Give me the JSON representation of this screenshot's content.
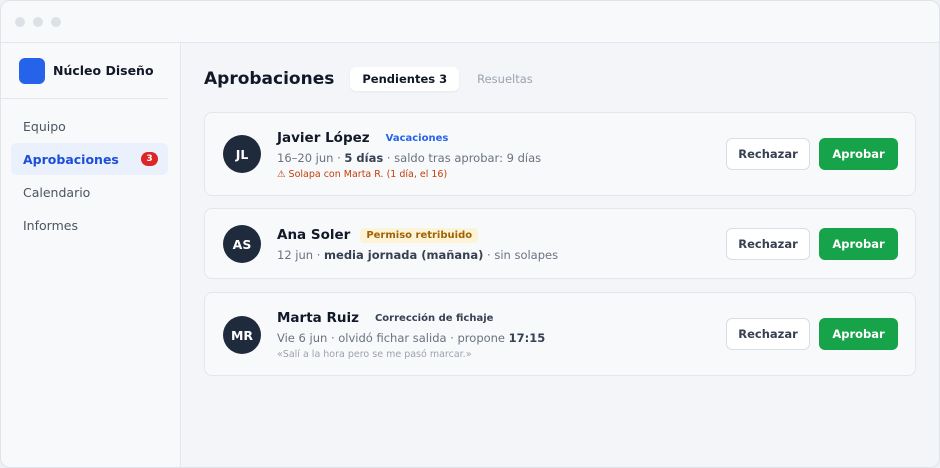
{
  "brand": {
    "name": "Núcleo Diseño"
  },
  "sidebar": {
    "items": [
      {
        "label": "Equipo"
      },
      {
        "label": "Aprobaciones",
        "badge": "3"
      },
      {
        "label": "Calendario"
      },
      {
        "label": "Informes"
      }
    ]
  },
  "header": {
    "title": "Aprobaciones",
    "tabs": [
      {
        "label": "Pendientes 3"
      },
      {
        "label": "Resueltas"
      }
    ]
  },
  "requests": [
    {
      "initials": "JL",
      "name": "Javier López",
      "tag": "Vacaciones",
      "detail_pre": "16–20 jun · ",
      "detail_bold": "5 días",
      "detail_post": " · saldo tras aprobar: 9 días",
      "note": "⚠ Solapa con Marta R. (1 día, el 16)",
      "reject": "Rechazar",
      "approve": "Aprobar"
    },
    {
      "initials": "AS",
      "name": "Ana Soler",
      "tag": "Permiso retribuido",
      "detail_pre": "12 jun · ",
      "detail_bold": "media jornada (mañana)",
      "detail_post": " · sin solapes",
      "reject": "Rechazar",
      "approve": "Aprobar"
    },
    {
      "initials": "MR",
      "name": "Marta Ruiz",
      "tag": "Corrección de fichaje",
      "detail_pre": "Vie 6 jun · olvidó fichar salida · propone ",
      "detail_bold": "17:15",
      "note": "«Salí a la hora pero se me pasó marcar.»",
      "reject": "Rechazar",
      "approve": "Aprobar"
    }
  ],
  "colors": {
    "accent": "#2563eb",
    "approve": "#16a34a",
    "badge": "#dc2626",
    "warning": "#c2410c",
    "avatar": "#1f2a3c"
  }
}
